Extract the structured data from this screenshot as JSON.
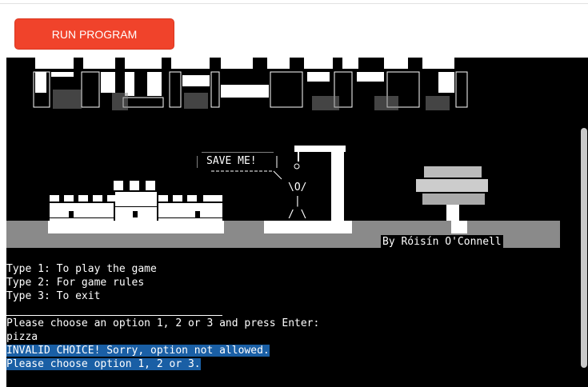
{
  "toolbar": {
    "run_label": "RUN PROGRAM"
  },
  "art": {
    "speech_bubble": "SAVE ME!",
    "byline": "By Róisín O'Connell"
  },
  "terminal": {
    "lines": [
      "Type 1: To play the game",
      "Type 2: For game rules",
      "Type 3: To exit",
      "",
      "Please choose an option 1, 2 or 3 and press Enter:",
      "pizza",
      "INVALID CHOICE! Sorry, option not allowed.",
      "Please choose option 1, 2 or 3."
    ]
  },
  "colors": {
    "run_button": "#f0432b",
    "terminal_bg": "#000000",
    "highlight": "#1a5fa5"
  }
}
